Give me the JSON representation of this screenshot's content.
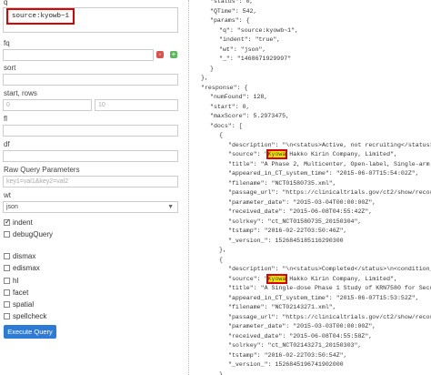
{
  "form": {
    "q_label": "q",
    "q_value": "source:kyowb~1",
    "fq_label": "fq",
    "fq_remove": "-",
    "fq_add": "+",
    "sort_label": "sort",
    "startrows_label": "start, rows",
    "start_value": "0",
    "rows_value": "10",
    "fl_label": "fl",
    "df_label": "df",
    "raw_label": "Raw Query Parameters",
    "raw_placeholder": "key1=val1&key2=val2",
    "wt_label": "wt",
    "wt_value": "json",
    "indent_label": "indent",
    "debug_label": "debugQuery",
    "dismax_label": "dismax",
    "edismax_label": "edismax",
    "hl_label": "hl",
    "facet_label": "facet",
    "spatial_label": "spatial",
    "spellcheck_label": "spellcheck",
    "execute_label": "Execute Query"
  },
  "json_lines": [
    {
      "i": 2,
      "t": "\"status\": 0,"
    },
    {
      "i": 2,
      "t": "\"QTime\": 542,"
    },
    {
      "i": 2,
      "t": "\"params\": {"
    },
    {
      "i": 3,
      "t": "\"q\": \"source:kyowb~1\","
    },
    {
      "i": 3,
      "t": "\"indent\": \"true\","
    },
    {
      "i": 3,
      "t": "\"wt\": \"json\","
    },
    {
      "i": 3,
      "t": "\"_\": \"1468671929997\""
    },
    {
      "i": 2,
      "t": "}"
    },
    {
      "i": 1,
      "t": "},"
    },
    {
      "i": 1,
      "t": "\"response\": {"
    },
    {
      "i": 2,
      "t": "\"numFound\": 128,"
    },
    {
      "i": 2,
      "t": "\"start\": 0,"
    },
    {
      "i": 2,
      "t": "\"maxScore\": 5.2973475,"
    },
    {
      "i": 2,
      "t": "\"docs\": ["
    },
    {
      "i": 3,
      "t": "{"
    },
    {
      "i": 4,
      "t": "\"description\": \"\\n<status>Active, not recruiting</status>\\n<condition_"
    },
    {
      "i": 4,
      "t": "\"source\": \"",
      "hl": "Kyowa",
      "rest": " Hakko Kirin Company, Limited\","
    },
    {
      "i": 4,
      "t": "\"title\": \"A Phase 2, Multicenter, Open-label, Single-arm Study of AB"
    },
    {
      "i": 4,
      "t": "\"appeared_in_CT_system_time\": \"2015-06-07T15:54:02Z\","
    },
    {
      "i": 4,
      "t": "\"filename\": \"NCT01580735.xml\","
    },
    {
      "i": 4,
      "t": "\"passage_url\": \"https://clinicaltrials.gov/ct2/show/record/NCT01580\""
    },
    {
      "i": 4,
      "t": "\"parameter_date\": \"2015-03-04T00:00:00Z\","
    },
    {
      "i": 4,
      "t": "\"received_date\": \"2015-06-08T04:55:42Z\","
    },
    {
      "i": 4,
      "t": "\"solrkey\": \"ct_NCT01580735_20150304\","
    },
    {
      "i": 4,
      "t": "\"tstamp\": \"2016-02-22T03:50:46Z\","
    },
    {
      "i": 4,
      "t": "\"_version_\": 1526845185116290300"
    },
    {
      "i": 3,
      "t": "},"
    },
    {
      "i": 3,
      "t": "{"
    },
    {
      "i": 4,
      "t": "\"description\": \"\\n<status>Completed</status>\\n<condition_summary>Secon"
    },
    {
      "i": 4,
      "t": "\"source\": \"",
      "hl": "Kyowa",
      "rest": " Hakko Kirin Company, Limited\","
    },
    {
      "i": 4,
      "t": "\"title\": \"A Single-dose Phase 1 Study of KRN7580 for Secondary Hyper"
    },
    {
      "i": 4,
      "t": "\"appeared_in_CT_system_time\": \"2015-06-07T15:53:52Z\","
    },
    {
      "i": 4,
      "t": "\"filename\": \"NCT02143271.xml\","
    },
    {
      "i": 4,
      "t": "\"passage_url\": \"https://clinicaltrials.gov/ct2/show/record/NCT02143\""
    },
    {
      "i": 4,
      "t": "\"parameter_date\": \"2015-03-03T00:00:00Z\","
    },
    {
      "i": 4,
      "t": "\"received_date\": \"2015-06-08T04:55:58Z\","
    },
    {
      "i": 4,
      "t": "\"solrkey\": \"ct_NCT02143271_20150303\","
    },
    {
      "i": 4,
      "t": "\"tstamp\": \"2016-02-22T03:50:54Z\","
    },
    {
      "i": 4,
      "t": "\"_version_\": 1526845196741902000"
    },
    {
      "i": 3,
      "t": "},"
    }
  ]
}
